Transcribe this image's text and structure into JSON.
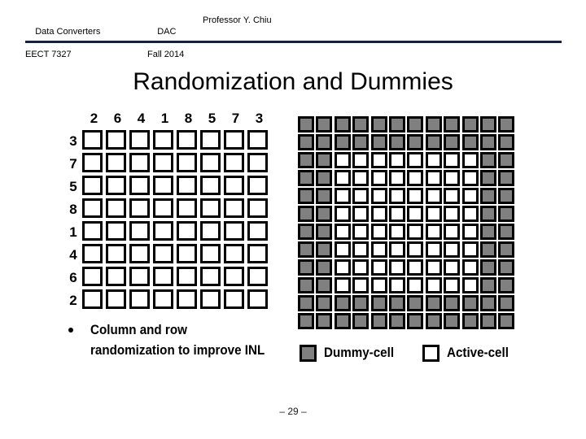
{
  "header": {
    "course_title": "Data Converters",
    "course_code": "EECT 7327",
    "event": "DAC",
    "term": "Fall 2014",
    "instructor": "Professor Y. Chiu",
    "rule_color": "#12233b"
  },
  "slide": {
    "title": "Randomization and Dummies",
    "page_number": "– 29 –"
  },
  "left_grid": {
    "column_headers": [
      "2",
      "6",
      "4",
      "1",
      "8",
      "5",
      "7",
      "3"
    ],
    "row_headers": [
      "3",
      "7",
      "5",
      "8",
      "1",
      "4",
      "6",
      "2"
    ],
    "rows": 8,
    "cols": 8,
    "cell_state": "active",
    "cell_fill": "#ffffff",
    "cell_border": "#000000"
  },
  "right_grid": {
    "rows": 12,
    "cols": 12,
    "dummy_color": "#808080",
    "active_color": "#ffffff",
    "border_color": "#000000",
    "matrix": [
      [
        "dummy",
        "dummy",
        "dummy",
        "dummy",
        "dummy",
        "dummy",
        "dummy",
        "dummy",
        "dummy",
        "dummy",
        "dummy",
        "dummy"
      ],
      [
        "dummy",
        "dummy",
        "dummy",
        "dummy",
        "dummy",
        "dummy",
        "dummy",
        "dummy",
        "dummy",
        "dummy",
        "dummy",
        "dummy"
      ],
      [
        "dummy",
        "dummy",
        "active",
        "active",
        "active",
        "active",
        "active",
        "active",
        "active",
        "active",
        "dummy",
        "dummy"
      ],
      [
        "dummy",
        "dummy",
        "active",
        "active",
        "active",
        "active",
        "active",
        "active",
        "active",
        "active",
        "dummy",
        "dummy"
      ],
      [
        "dummy",
        "dummy",
        "active",
        "active",
        "active",
        "active",
        "active",
        "active",
        "active",
        "active",
        "dummy",
        "dummy"
      ],
      [
        "dummy",
        "dummy",
        "active",
        "active",
        "active",
        "active",
        "active",
        "active",
        "active",
        "active",
        "dummy",
        "dummy"
      ],
      [
        "dummy",
        "dummy",
        "active",
        "active",
        "active",
        "active",
        "active",
        "active",
        "active",
        "active",
        "dummy",
        "dummy"
      ],
      [
        "dummy",
        "dummy",
        "active",
        "active",
        "active",
        "active",
        "active",
        "active",
        "active",
        "active",
        "dummy",
        "dummy"
      ],
      [
        "dummy",
        "dummy",
        "active",
        "active",
        "active",
        "active",
        "active",
        "active",
        "active",
        "active",
        "dummy",
        "dummy"
      ],
      [
        "dummy",
        "dummy",
        "active",
        "active",
        "active",
        "active",
        "active",
        "active",
        "active",
        "active",
        "dummy",
        "dummy"
      ],
      [
        "dummy",
        "dummy",
        "dummy",
        "dummy",
        "dummy",
        "dummy",
        "dummy",
        "dummy",
        "dummy",
        "dummy",
        "dummy",
        "dummy"
      ],
      [
        "dummy",
        "dummy",
        "dummy",
        "dummy",
        "dummy",
        "dummy",
        "dummy",
        "dummy",
        "dummy",
        "dummy",
        "dummy",
        "dummy"
      ]
    ]
  },
  "bullet": {
    "text": "Column and row randomization to improve INL",
    "marker": "bullet-dot"
  },
  "legend": {
    "dummy_label": "Dummy-cell",
    "active_label": "Active-cell"
  }
}
